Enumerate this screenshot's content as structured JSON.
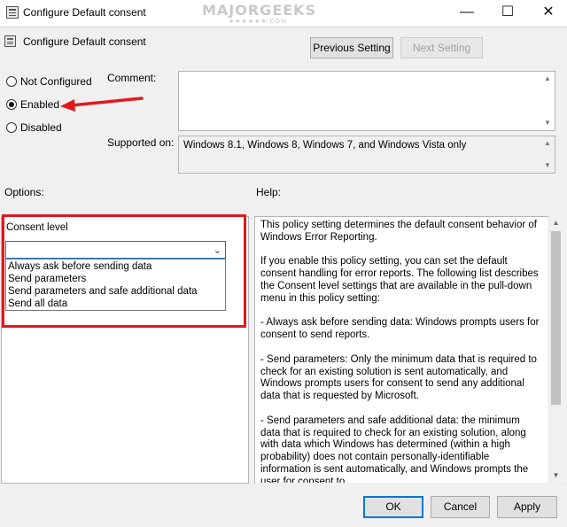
{
  "window": {
    "title": "Configure Default consent",
    "watermark": "MAJORGEEKS",
    "watermark_stars": "★★★★★★.COM",
    "minimize_glyph": "—",
    "maximize_glyph": "☐",
    "close_glyph": "✕"
  },
  "header": {
    "policy_title": "Configure Default consent",
    "previous_setting": "Previous Setting",
    "next_setting": "Next Setting"
  },
  "state": {
    "options": [
      {
        "label": "Not Configured",
        "checked": false
      },
      {
        "label": "Enabled",
        "checked": true
      },
      {
        "label": "Disabled",
        "checked": false
      }
    ]
  },
  "comment": {
    "label": "Comment:",
    "value": ""
  },
  "supported_on": {
    "label": "Supported on:",
    "value": "Windows 8.1, Windows 8, Windows 7, and Windows Vista only"
  },
  "sections": {
    "options_label": "Options:",
    "help_label": "Help:"
  },
  "options_panel": {
    "consent_label": "Consent level",
    "selected_value": "",
    "dropdown_items": [
      "Always ask before sending data",
      "Send parameters",
      "Send parameters and safe additional data",
      "Send all data"
    ]
  },
  "help_paragraphs": [
    "This policy setting determines the default consent behavior of Windows Error Reporting.",
    "If you enable this policy setting, you can set the default consent handling for error reports. The following list describes the Consent level settings that are available in the pull-down menu in this policy setting:",
    "- Always ask before sending data: Windows prompts users for consent to send reports.",
    "- Send parameters: Only the minimum data that is required to check for an existing solution is sent automatically, and Windows prompts users for consent to send any additional data that is requested by Microsoft.",
    "- Send parameters and safe additional data: the minimum data that is required to check for an existing solution, along with data which Windows has determined (within a high probability) does not contain personally-identifiable information is sent automatically, and Windows prompts the user for consent to"
  ],
  "footer": {
    "ok": "OK",
    "cancel": "Cancel",
    "apply": "Apply"
  },
  "colors": {
    "highlight_box": "#e0191e",
    "arrow": "#e0191e",
    "focus_border": "#0078d7"
  }
}
